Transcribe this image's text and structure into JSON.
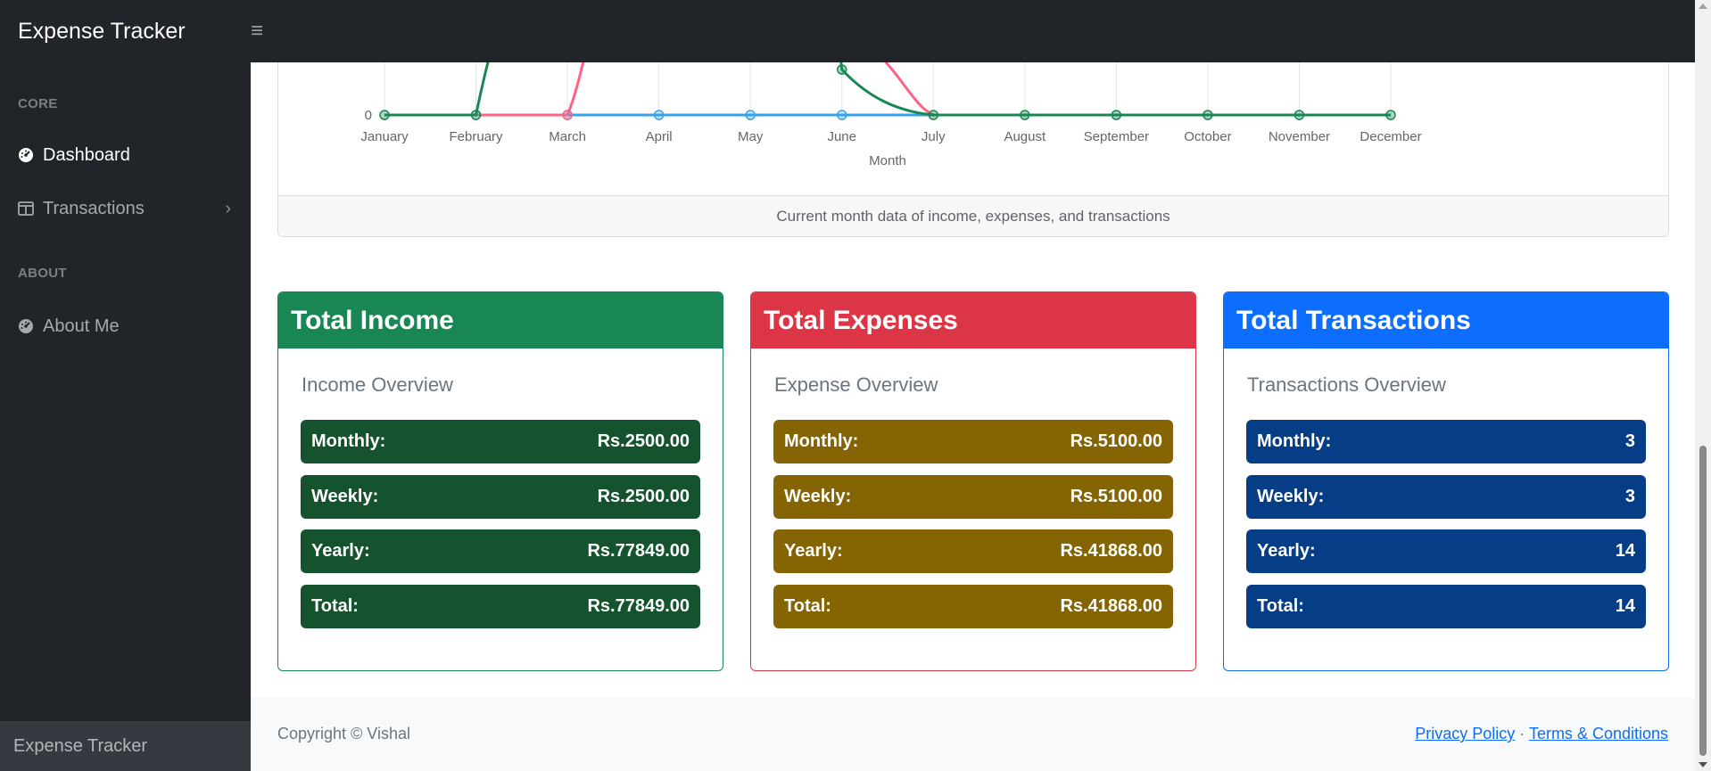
{
  "app": {
    "brand": "Expense Tracker",
    "menu_icon": "hamburger-icon"
  },
  "sidebar": {
    "sections": [
      {
        "heading": "CORE"
      },
      {
        "heading": "ABOUT"
      }
    ],
    "items": [
      {
        "label": "Dashboard",
        "icon": "dashboard-gauge-icon"
      },
      {
        "label": "Transactions",
        "icon": "columns-icon"
      },
      {
        "label": "About Me",
        "icon": "dashboard-gauge-icon"
      }
    ],
    "footer": "Expense Tracker"
  },
  "chart_data": {
    "type": "line",
    "categories": [
      "January",
      "February",
      "March",
      "April",
      "May",
      "June",
      "July",
      "August",
      "September",
      "October",
      "November",
      "December"
    ],
    "xlabel": "Month",
    "y_tick_visible": "0",
    "series": [
      {
        "color": "#198754",
        "values": [
          0,
          null,
          0,
          0,
          0,
          null,
          0,
          0,
          0,
          0,
          0,
          0
        ]
      },
      {
        "color": "#ff6384",
        "values": [
          null,
          0,
          0,
          null,
          null,
          null,
          0,
          null,
          null,
          null,
          null,
          null
        ]
      },
      {
        "color": "#36a2eb",
        "values": [
          null,
          null,
          0,
          0,
          0,
          0,
          0,
          null,
          null,
          null,
          null,
          null
        ]
      }
    ],
    "caption": "Current month data of income, expenses, and transactions"
  },
  "colors": {
    "income_header": "#198754",
    "income_row": "#14532d",
    "expense_header": "#dc3545",
    "expense_row": "#856404",
    "transaction_header": "#0d6efd",
    "transaction_row": "#053d86"
  },
  "cards": {
    "income": {
      "title": "Total Income",
      "subtitle": "Income Overview",
      "rows": [
        {
          "label": "Monthly:",
          "value": "Rs.2500.00"
        },
        {
          "label": "Weekly:",
          "value": "Rs.2500.00"
        },
        {
          "label": "Yearly:",
          "value": "Rs.77849.00"
        },
        {
          "label": "Total:",
          "value": "Rs.77849.00"
        }
      ]
    },
    "expenses": {
      "title": "Total Expenses",
      "subtitle": "Expense Overview",
      "rows": [
        {
          "label": "Monthly:",
          "value": "Rs.5100.00"
        },
        {
          "label": "Weekly:",
          "value": "Rs.5100.00"
        },
        {
          "label": "Yearly:",
          "value": "Rs.41868.00"
        },
        {
          "label": "Total:",
          "value": "Rs.41868.00"
        }
      ]
    },
    "transactions": {
      "title": "Total Transactions",
      "subtitle": "Transactions Overview",
      "rows": [
        {
          "label": "Monthly:",
          "value": "3"
        },
        {
          "label": "Weekly:",
          "value": "3"
        },
        {
          "label": "Yearly:",
          "value": "14"
        },
        {
          "label": "Total:",
          "value": "14"
        }
      ]
    }
  },
  "footer": {
    "copyright": "Copyright © Vishal",
    "privacy": "Privacy Policy",
    "separator": "·",
    "terms": "Terms & Conditions"
  }
}
